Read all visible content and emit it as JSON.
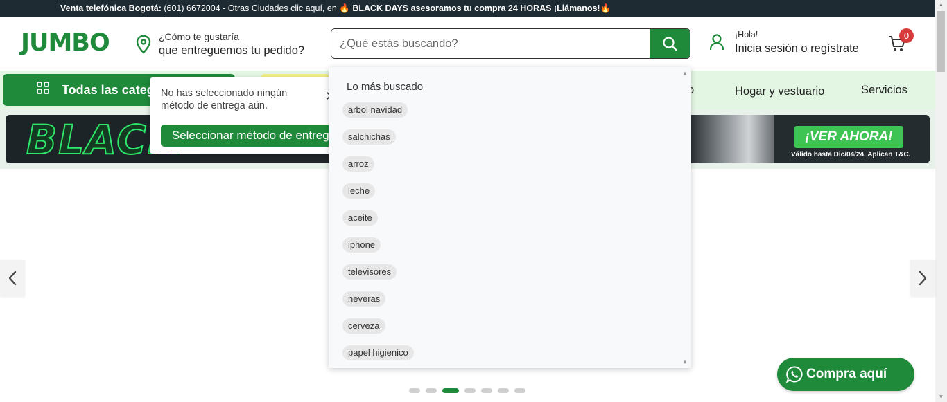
{
  "topbar": {
    "bold1": "Venta telefónica Bogotá:",
    "text1": " (601) 6672004 - Otras Ciudades clic aquí, en ",
    "bold2": "BLACK DAYS asesoramos tu compra 24 HORAS ¡Llámanos!"
  },
  "header": {
    "logo": "JUMBO",
    "delivery_line1": "¿Cómo te gustaría",
    "delivery_line2": "que entreguemos tu pedido?",
    "search_placeholder": "¿Qué estás buscando?",
    "greeting": "¡Hola!",
    "login_text": "Inicia sesión o regístrate",
    "cart_count": "0"
  },
  "nav": {
    "all_categories": "Todas las categorías",
    "items": [
      {
        "label": "o"
      },
      {
        "label": "Hogar y vestuario"
      },
      {
        "label": "Servicios"
      }
    ]
  },
  "banner": {
    "headline": "BLACK",
    "cta": "¡VER AHORA!",
    "disclaimer": "Válido hasta Dic/04/24. Aplican T&C."
  },
  "delivery_popover": {
    "message": "No has seleccionado ningún método de entrega aún.",
    "button": "Seleccionar método de entrega"
  },
  "search_dropdown": {
    "title": "Lo más buscado",
    "suggestions": [
      "arbol navidad",
      "salchichas",
      "arroz",
      "leche",
      "aceite",
      "iphone",
      "televisores",
      "neveras",
      "cerveza",
      "papel higienico"
    ]
  },
  "carousel": {
    "slides": 7,
    "active_slide": 3
  },
  "whatsapp": {
    "label": "Compra aquí"
  },
  "colors": {
    "brand_green": "#1f8a3a",
    "nav_bg": "#e3f6e3",
    "topbar_bg": "#1f2b33",
    "badge_red": "#d63b3b"
  }
}
